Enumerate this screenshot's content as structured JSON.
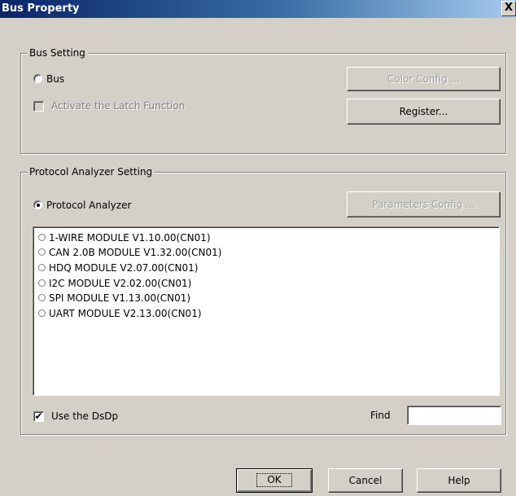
{
  "window": {
    "title": "Bus Property",
    "close_glyph": "X"
  },
  "bus_setting": {
    "legend": "Bus Setting",
    "bus_radio_label": "Bus",
    "bus_radio_checked": false,
    "latch_checkbox_label": "Activate the Latch Function",
    "latch_checkbox_checked": false,
    "color_config_label": "Color Config ...",
    "register_label": "Register..."
  },
  "protocol_setting": {
    "legend": "Protocol Analyzer Setting",
    "analyzer_radio_label": "Protocol Analyzer",
    "analyzer_radio_checked": true,
    "parameters_config_label": "Parameters Config ...",
    "modules": [
      "1-WIRE MODULE V1.10.00(CN01)",
      "CAN 2.0B MODULE V1.32.00(CN01)",
      "HDQ MODULE V2.07.00(CN01)",
      "I2C MODULE V2.02.00(CN01)",
      "SPI MODULE V1.13.00(CN01)",
      "UART MODULE V2.13.00(CN01)"
    ],
    "use_dsdp_label": "Use the DsDp",
    "use_dsdp_checked": true,
    "find_label": "Find",
    "find_value": ""
  },
  "footer": {
    "ok_label": "OK",
    "cancel_label": "Cancel",
    "help_label": "Help"
  },
  "colors": {
    "titlebar_start": "#0a246a",
    "titlebar_end": "#a6caf0",
    "face": "#d4d0c8",
    "disabled_text": "#a0a0a0"
  },
  "icons": {
    "close": "close-icon",
    "check": "checkmark-icon"
  }
}
